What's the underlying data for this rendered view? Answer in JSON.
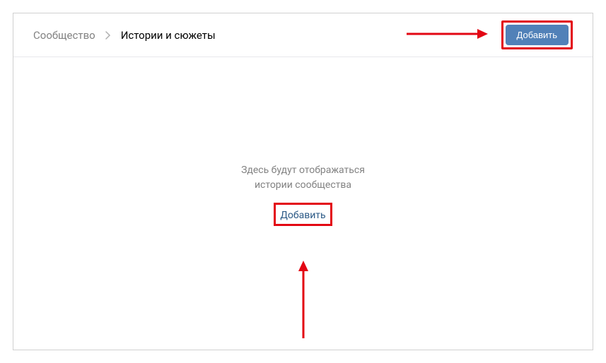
{
  "breadcrumb": {
    "parent": "Сообщество",
    "current": "Истории и сюжеты"
  },
  "header": {
    "add_button_label": "Добавить"
  },
  "empty_state": {
    "line1": "Здесь будут отображаться",
    "line2": "истории сообщества",
    "add_link_label": "Добавить"
  },
  "annotations": {
    "highlight_color": "#e30613"
  }
}
